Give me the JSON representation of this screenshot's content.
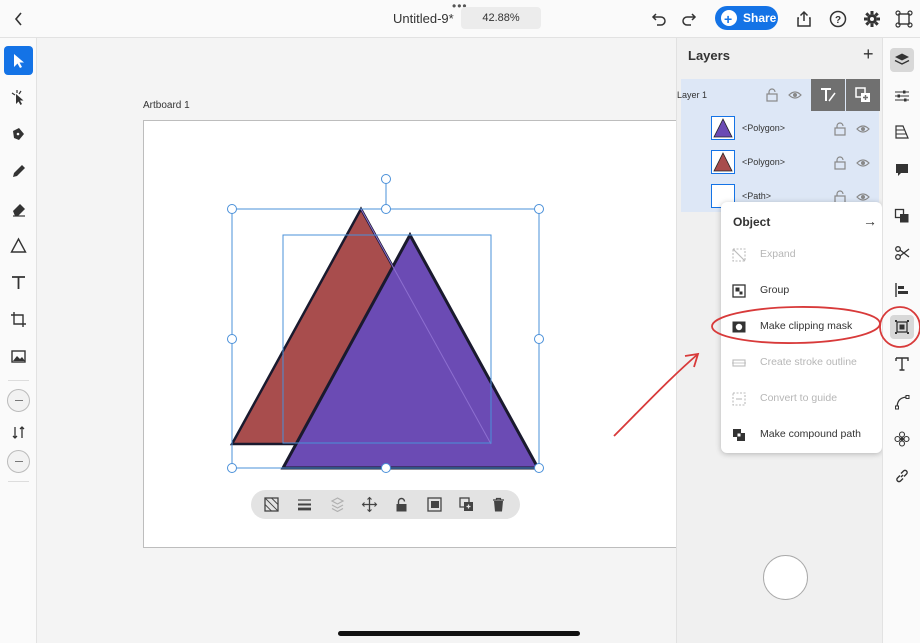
{
  "app": {
    "document_title": "Untitled-9*",
    "zoom": "42.88%",
    "share_label": "Share"
  },
  "canvas": {
    "artboard_label": "Artboard 1",
    "shapes": {
      "back_triangle_color": "#a84d4d",
      "front_triangle_color": "#6b4bb4",
      "outline_color": "#1a1a2e",
      "selection_color": "#4a90d9"
    }
  },
  "layers": {
    "title": "Layers",
    "group_name": "Layer 1",
    "items": [
      {
        "label": "<Polygon>",
        "thumb": "purple-triangle"
      },
      {
        "label": "<Polygon>",
        "thumb": "red-triangle"
      },
      {
        "label": "<Path>",
        "thumb": "empty-square"
      }
    ]
  },
  "context_menu": {
    "title": "Object",
    "items": [
      {
        "label": "Expand",
        "icon": "expand-icon",
        "enabled": false
      },
      {
        "label": "Group",
        "icon": "group-icon",
        "enabled": true
      },
      {
        "label": "Make clipping mask",
        "icon": "clipping-mask-icon",
        "enabled": true
      },
      {
        "label": "Create stroke outline",
        "icon": "stroke-outline-icon",
        "enabled": false
      },
      {
        "label": "Convert to guide",
        "icon": "guide-icon",
        "enabled": false
      },
      {
        "label": "Make compound path",
        "icon": "compound-path-icon",
        "enabled": true
      }
    ]
  },
  "colors": {
    "accent": "#1473e6",
    "annotation": "#d83a3a"
  }
}
